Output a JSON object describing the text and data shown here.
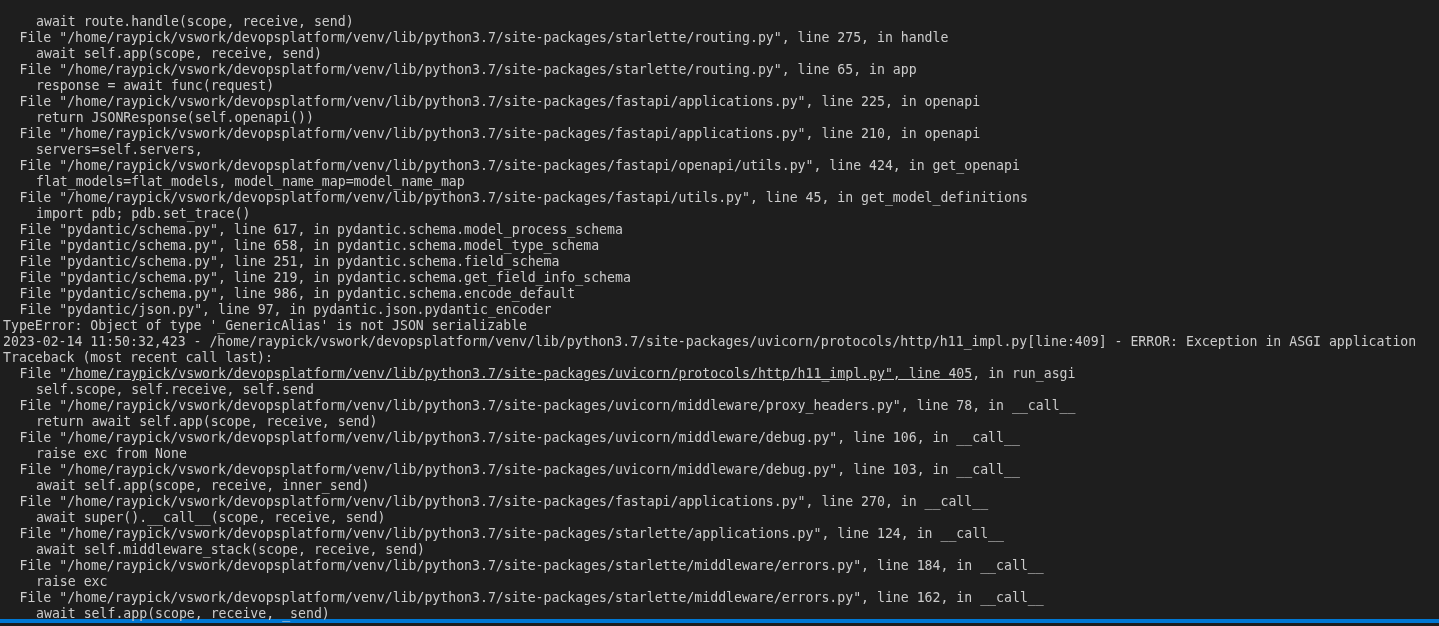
{
  "terminal": {
    "lines": [
      {
        "kind": "code",
        "text": "await route.handle(scope, receive, send)"
      },
      {
        "kind": "frame",
        "text": "File \"/home/raypick/vswork/devopsplatform/venv/lib/python3.7/site-packages/starlette/routing.py\", line 275, in handle"
      },
      {
        "kind": "code",
        "text": "await self.app(scope, receive, send)"
      },
      {
        "kind": "frame",
        "text": "File \"/home/raypick/vswork/devopsplatform/venv/lib/python3.7/site-packages/starlette/routing.py\", line 65, in app"
      },
      {
        "kind": "code",
        "text": "response = await func(request)"
      },
      {
        "kind": "frame",
        "text": "File \"/home/raypick/vswork/devopsplatform/venv/lib/python3.7/site-packages/fastapi/applications.py\", line 225, in openapi"
      },
      {
        "kind": "code",
        "text": "return JSONResponse(self.openapi())"
      },
      {
        "kind": "frame",
        "text": "File \"/home/raypick/vswork/devopsplatform/venv/lib/python3.7/site-packages/fastapi/applications.py\", line 210, in openapi"
      },
      {
        "kind": "code",
        "text": "servers=self.servers,"
      },
      {
        "kind": "frame",
        "text": "File \"/home/raypick/vswork/devopsplatform/venv/lib/python3.7/site-packages/fastapi/openapi/utils.py\", line 424, in get_openapi"
      },
      {
        "kind": "code",
        "text": "flat_models=flat_models, model_name_map=model_name_map"
      },
      {
        "kind": "frame",
        "text": "File \"/home/raypick/vswork/devopsplatform/venv/lib/python3.7/site-packages/fastapi/utils.py\", line 45, in get_model_definitions"
      },
      {
        "kind": "code",
        "text": "import pdb; pdb.set_trace()"
      },
      {
        "kind": "frame",
        "text": "File \"pydantic/schema.py\", line 617, in pydantic.schema.model_process_schema"
      },
      {
        "kind": "frame",
        "text": "File \"pydantic/schema.py\", line 658, in pydantic.schema.model_type_schema"
      },
      {
        "kind": "frame",
        "text": "File \"pydantic/schema.py\", line 251, in pydantic.schema.field_schema"
      },
      {
        "kind": "frame",
        "text": "File \"pydantic/schema.py\", line 219, in pydantic.schema.get_field_info_schema"
      },
      {
        "kind": "frame",
        "text": "File \"pydantic/schema.py\", line 986, in pydantic.schema.encode_default"
      },
      {
        "kind": "frame",
        "text": "File \"pydantic/json.py\", line 97, in pydantic.json.pydantic_encoder"
      },
      {
        "kind": "plain",
        "text": "TypeError: Object of type '_GenericAlias' is not JSON serializable"
      },
      {
        "kind": "plain",
        "text": "2023-02-14 11:50:32,423 - /home/raypick/vswork/devopsplatform/venv/lib/python3.7/site-packages/uvicorn/protocols/http/h11_impl.py[line:409] - ERROR: Exception in ASGI application"
      },
      {
        "kind": "plain",
        "text": "Traceback (most recent call last):"
      },
      {
        "kind": "link",
        "prefix": "File \"",
        "link": "/home/raypick/vswork/devopsplatform/venv/lib/python3.7/site-packages/uvicorn/protocols/http/h11_impl.py\", line 405",
        "suffix": ", in run_asgi"
      },
      {
        "kind": "code",
        "text": "self.scope, self.receive, self.send"
      },
      {
        "kind": "frame",
        "text": "File \"/home/raypick/vswork/devopsplatform/venv/lib/python3.7/site-packages/uvicorn/middleware/proxy_headers.py\", line 78, in __call__"
      },
      {
        "kind": "code",
        "text": "return await self.app(scope, receive, send)"
      },
      {
        "kind": "frame",
        "text": "File \"/home/raypick/vswork/devopsplatform/venv/lib/python3.7/site-packages/uvicorn/middleware/debug.py\", line 106, in __call__"
      },
      {
        "kind": "code",
        "text": "raise exc from None"
      },
      {
        "kind": "frame",
        "text": "File \"/home/raypick/vswork/devopsplatform/venv/lib/python3.7/site-packages/uvicorn/middleware/debug.py\", line 103, in __call__"
      },
      {
        "kind": "code",
        "text": "await self.app(scope, receive, inner_send)"
      },
      {
        "kind": "frame",
        "text": "File \"/home/raypick/vswork/devopsplatform/venv/lib/python3.7/site-packages/fastapi/applications.py\", line 270, in __call__"
      },
      {
        "kind": "code",
        "text": "await super().__call__(scope, receive, send)"
      },
      {
        "kind": "frame",
        "text": "File \"/home/raypick/vswork/devopsplatform/venv/lib/python3.7/site-packages/starlette/applications.py\", line 124, in __call__"
      },
      {
        "kind": "code",
        "text": "await self.middleware_stack(scope, receive, send)"
      },
      {
        "kind": "frame",
        "text": "File \"/home/raypick/vswork/devopsplatform/venv/lib/python3.7/site-packages/starlette/middleware/errors.py\", line 184, in __call__"
      },
      {
        "kind": "code",
        "text": "raise exc"
      },
      {
        "kind": "frame",
        "text": "File \"/home/raypick/vswork/devopsplatform/venv/lib/python3.7/site-packages/starlette/middleware/errors.py\", line 162, in __call__"
      },
      {
        "kind": "code",
        "text": "await self.app(scope, receive, _send)"
      }
    ]
  }
}
